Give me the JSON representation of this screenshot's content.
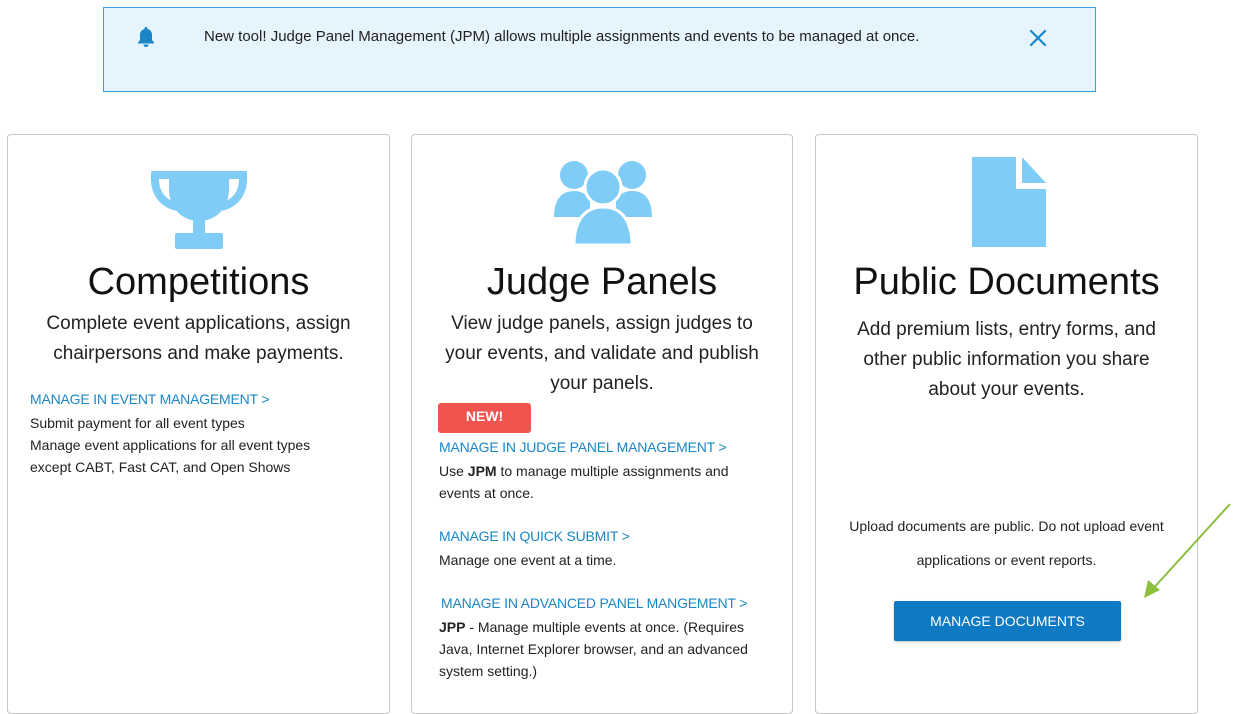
{
  "banner": {
    "message": "New tool! Judge Panel Management (JPM) allows multiple assignments and events to be managed at once.",
    "icon": "bell-icon",
    "close_icon": "close-icon"
  },
  "colors": {
    "accent": "#1a86c8",
    "icon_blue": "#7fcdf7",
    "badge_red": "#f0544f",
    "button_blue": "#0f7ac4",
    "banner_bg": "#e6f4fd",
    "banner_border": "#3b9be0",
    "arrow_green": "#8bbf3e"
  },
  "cards": {
    "competitions": {
      "icon": "trophy-icon",
      "title": "Competitions",
      "desc_line1": "Complete event applications, assign",
      "desc_line2": "chairpersons and make payments.",
      "link": "MANAGE IN EVENT MANAGEMENT >",
      "note1": "Submit payment for all event types",
      "note2": "Manage event applications for all event types",
      "note3": "except CABT, Fast CAT, and Open Shows"
    },
    "judge_panels": {
      "icon": "people-group-icon",
      "title": "Judge Panels",
      "desc_line1": "View judge panels, assign judges to",
      "desc_line2": "your events, and validate and publish",
      "desc_line3": "your panels.",
      "badge": "NEW!",
      "link1": "MANAGE IN JUDGE PANEL MANAGEMENT >",
      "note1_pre": "Use ",
      "note1_bold": "JPM",
      "note1_post": " to manage multiple assignments and",
      "note1_line2": "events at once.",
      "link2": "MANAGE IN QUICK SUBMIT >",
      "note2": "Manage one event at a time.",
      "link3": "MANAGE IN ADVANCED PANEL MANGEMENT >",
      "note3_bold": "JPP",
      "note3_post": " - Manage multiple events at once. (Requires",
      "note3_line2": "Java, Internet Explorer browser, and an advanced",
      "note3_line3": "system setting.)"
    },
    "public_documents": {
      "icon": "document-icon",
      "title": "Public Documents",
      "desc_line1": "Add premium lists, entry forms, and",
      "desc_line2": "other public information you share",
      "desc_line3": "about your events.",
      "note_line1": "Upload documents are public. Do not upload event",
      "note_line2": "applications or event reports.",
      "button": "MANAGE DOCUMENTS"
    }
  },
  "annotation": {
    "icon": "arrow-annotation-icon"
  }
}
